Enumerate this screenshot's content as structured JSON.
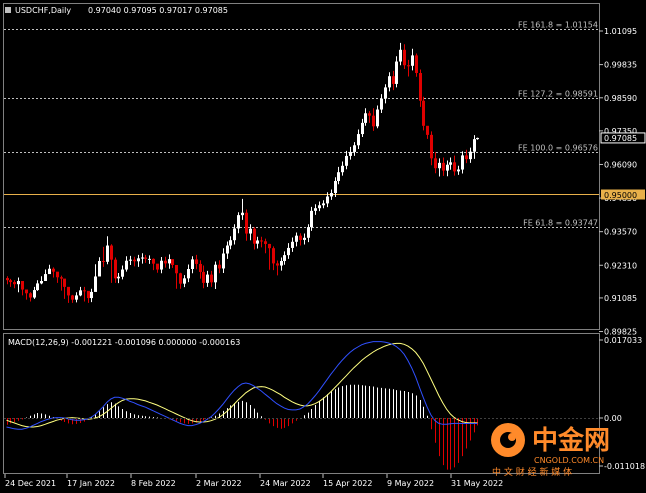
{
  "header": {
    "symbol": "USDCHF,Daily",
    "ohlc": "0.97040 0.97095 0.97017 0.97085"
  },
  "price_scale": {
    "labels": [
      "1.01095",
      "0.99835",
      "0.98590",
      "0.97350",
      "0.96090",
      "0.94830",
      "0.93570",
      "0.92310",
      "0.91085",
      "0.89825"
    ],
    "values": [
      1.01095,
      0.99835,
      0.9859,
      0.9735,
      0.9609,
      0.9483,
      0.9357,
      0.9231,
      0.91085,
      0.89825
    ],
    "current_price_label": "0.97085",
    "current_price": 0.97085,
    "level_label": "0.95000",
    "level": 0.95
  },
  "fib_levels": [
    {
      "label": "FE 161.8 = 1.01154",
      "value": 1.01154
    },
    {
      "label": "FE 127.2 = 0.98591",
      "value": 0.98591
    },
    {
      "label": "FE 100.0 = 0.96576",
      "value": 0.96576
    },
    {
      "label": "FE 61.8 = 0.93747",
      "value": 0.93747
    }
  ],
  "macd": {
    "header": "MACD(12,26,9) -0.001221 -0.001096 0.000000 -0.000163",
    "scale_labels": [
      "0.017033",
      "0.00",
      "-0.011018"
    ]
  },
  "time_axis": [
    "24 Dec 2021",
    "17 Jan 2022",
    "8 Feb 2022",
    "2 Mar 2022",
    "24 Mar 2022",
    "15 Apr 2022",
    "9 May 2022",
    "31 May 2022"
  ],
  "watermark": {
    "brand": "中金网",
    "sub": "中 文 财 经 新 媒 体",
    "url": "CNGOLD.COM.CN"
  },
  "colors": {
    "background": "#000000",
    "bull": "#ffffff",
    "bear": "#e00000",
    "grid": "#c0c0c0",
    "level_line": "#e8b04a",
    "macd_signal": "#ffff80",
    "macd_main": "#3050ff",
    "hist_pos": "#ffffff",
    "hist_neg": "#e00000",
    "watermark": "#ff8a2a"
  },
  "chart_data": {
    "type": "candlestick",
    "closes": [
      0.9175,
      0.9168,
      0.916,
      0.9172,
      0.914,
      0.9126,
      0.911,
      0.9138,
      0.9163,
      0.9172,
      0.9198,
      0.9218,
      0.9207,
      0.9186,
      0.9181,
      0.915,
      0.9118,
      0.9102,
      0.9118,
      0.9137,
      0.9135,
      0.9108,
      0.9131,
      0.9189,
      0.9247,
      0.9244,
      0.9305,
      0.9252,
      0.9182,
      0.9188,
      0.9215,
      0.9248,
      0.9252,
      0.9246,
      0.9257,
      0.926,
      0.9255,
      0.9255,
      0.9237,
      0.9215,
      0.9248,
      0.9238,
      0.9254,
      0.9232,
      0.9201,
      0.9162,
      0.9182,
      0.9217,
      0.9253,
      0.9236,
      0.9206,
      0.9165,
      0.9196,
      0.9167,
      0.9233,
      0.9219,
      0.9275,
      0.9305,
      0.9325,
      0.9369,
      0.9419,
      0.9428,
      0.935,
      0.9368,
      0.9312,
      0.9324,
      0.9321,
      0.9311,
      0.9295,
      0.9238,
      0.923,
      0.9247,
      0.9269,
      0.9296,
      0.9319,
      0.9342,
      0.9326,
      0.9334,
      0.9374,
      0.9435,
      0.9445,
      0.9456,
      0.9463,
      0.9489,
      0.9502,
      0.9547,
      0.958,
      0.9604,
      0.9641,
      0.9656,
      0.9681,
      0.9723,
      0.9765,
      0.9801,
      0.9792,
      0.9752,
      0.9815,
      0.9856,
      0.9898,
      0.994,
      0.9911,
      0.9995,
      1.0039,
      0.9981,
      0.9979,
      1.0018,
      0.9952,
      0.9848,
      0.9754,
      0.972,
      0.9632,
      0.9595,
      0.9615,
      0.9586,
      0.9608,
      0.9617,
      0.9583,
      0.959,
      0.9643,
      0.9629,
      0.9657,
      0.9704,
      0.97085
    ],
    "highs": [
      0.919,
      0.918,
      0.9175,
      0.9185,
      0.916,
      0.914,
      0.913,
      0.915,
      0.9175,
      0.919,
      0.9215,
      0.9233,
      0.9223,
      0.9203,
      0.9192,
      0.917,
      0.914,
      0.912,
      0.913,
      0.915,
      0.915,
      0.9125,
      0.9143,
      0.9235,
      0.9261,
      0.93,
      0.934,
      0.931,
      0.926,
      0.9202,
      0.923,
      0.9265,
      0.9266,
      0.9263,
      0.927,
      0.9276,
      0.927,
      0.9268,
      0.9257,
      0.9235,
      0.9262,
      0.9263,
      0.9272,
      0.9252,
      0.9232,
      0.9203,
      0.9194,
      0.9234,
      0.9265,
      0.927,
      0.925,
      0.923,
      0.921,
      0.921,
      0.9245,
      0.925,
      0.9295,
      0.932,
      0.934,
      0.9385,
      0.943,
      0.948,
      0.944,
      0.9385,
      0.9374,
      0.9338,
      0.9338,
      0.9331,
      0.9311,
      0.9302,
      0.9249,
      0.926,
      0.9283,
      0.9314,
      0.9335,
      0.9354,
      0.9351,
      0.935,
      0.9385,
      0.945,
      0.946,
      0.947,
      0.9475,
      0.9505,
      0.9515,
      0.9561,
      0.96,
      0.962,
      0.966,
      0.9675,
      0.9693,
      0.974,
      0.978,
      0.982,
      0.9809,
      0.982,
      0.983,
      0.9873,
      0.991,
      0.9955,
      0.996,
      1.0015,
      1.0065,
      1.006,
      1.0001,
      1.0043,
      1.0025,
      0.9965,
      0.9863,
      0.9736,
      0.9733,
      0.9655,
      0.9632,
      0.9635,
      0.9624,
      0.9635,
      0.9642,
      0.9604,
      0.9658,
      0.9664,
      0.9672,
      0.9719,
      0.97095
    ],
    "lows": [
      0.916,
      0.915,
      0.9145,
      0.913,
      0.9118,
      0.9102,
      0.9095,
      0.9105,
      0.9135,
      0.916,
      0.918,
      0.92,
      0.9185,
      0.9165,
      0.9136,
      0.9105,
      0.909,
      0.909,
      0.9092,
      0.9115,
      0.9095,
      0.909,
      0.9093,
      0.917,
      0.922,
      0.9225,
      0.9235,
      0.9165,
      0.9165,
      0.9164,
      0.9178,
      0.9207,
      0.9232,
      0.9227,
      0.9225,
      0.9237,
      0.924,
      0.9236,
      0.9213,
      0.9203,
      0.9201,
      0.9222,
      0.9218,
      0.9221,
      0.9143,
      0.9143,
      0.9149,
      0.9168,
      0.9201,
      0.9216,
      0.9181,
      0.9145,
      0.915,
      0.915,
      0.9142,
      0.9201,
      0.9202,
      0.9255,
      0.9291,
      0.9309,
      0.9351,
      0.9401,
      0.9323,
      0.9325,
      0.929,
      0.9294,
      0.9298,
      0.9276,
      0.9214,
      0.9213,
      0.9193,
      0.9211,
      0.9233,
      0.9255,
      0.9281,
      0.9302,
      0.9305,
      0.9309,
      0.9318,
      0.936,
      0.942,
      0.9434,
      0.9445,
      0.9449,
      0.9476,
      0.9487,
      0.9535,
      0.9567,
      0.9591,
      0.9627,
      0.9641,
      0.9667,
      0.9712,
      0.9754,
      0.9765,
      0.9735,
      0.9745,
      0.9802,
      0.9838,
      0.9883,
      0.9888,
      0.9898,
      0.9981,
      0.9967,
      0.9939,
      0.9962,
      0.9938,
      0.9825,
      0.9737,
      0.9705,
      0.9606,
      0.9576,
      0.9564,
      0.9566,
      0.9565,
      0.9589,
      0.9567,
      0.957,
      0.9575,
      0.9614,
      0.9615,
      0.963,
      0.97017
    ],
    "macd_histogram": [
      -0.0015,
      -0.0012,
      -0.0009,
      -0.0006,
      -0.0003,
      0.0001,
      0.0005,
      0.0008,
      0.0011,
      0.001,
      0.0008,
      0.0005,
      0.0002,
      -0.0002,
      -0.0006,
      -0.0009,
      -0.0012,
      -0.0014,
      -0.0013,
      -0.0011,
      -0.0008,
      -0.0004,
      0.0001,
      0.0008,
      0.0015,
      0.0024,
      0.0031,
      0.0035,
      0.0032,
      0.0026,
      0.002,
      0.0015,
      0.0011,
      0.0008,
      0.0006,
      0.0005,
      0.0004,
      0.0003,
      0.0002,
      0.0001,
      0.0,
      -0.0002,
      -0.0003,
      -0.0005,
      -0.0007,
      -0.001,
      -0.0012,
      -0.0013,
      -0.0012,
      -0.001,
      -0.0008,
      -0.0005,
      -0.0002,
      0.0001,
      0.0005,
      0.001,
      0.0016,
      0.0022,
      0.0028,
      0.0033,
      0.0036,
      0.0038,
      0.0035,
      0.0029,
      0.0021,
      0.0012,
      0.0004,
      -0.0004,
      -0.0012,
      -0.0018,
      -0.0022,
      -0.0024,
      -0.0022,
      -0.0018,
      -0.0012,
      -0.0006,
      0.0,
      0.0006,
      0.0012,
      0.002,
      0.0029,
      0.0038,
      0.0046,
      0.0053,
      0.0059,
      0.0064,
      0.0068,
      0.0071,
      0.0073,
      0.0074,
      0.0074,
      0.0074,
      0.0073,
      0.0072,
      0.0071,
      0.007,
      0.0068,
      0.0067,
      0.0066,
      0.0065,
      0.0064,
      0.0062,
      0.0061,
      0.006,
      0.0058,
      0.0055,
      0.005,
      0.004,
      0.0025,
      0.0005,
      -0.0025,
      -0.0055,
      -0.0085,
      -0.0105,
      -0.0115,
      -0.0115,
      -0.011,
      -0.01,
      -0.0085,
      -0.0068,
      -0.005,
      -0.0032,
      -0.00163
    ],
    "macd_main": [
      -0.002,
      -0.0022,
      -0.0024,
      -0.0025,
      -0.0025,
      -0.0023,
      -0.002,
      -0.0016,
      -0.0012,
      -0.0008,
      -0.0005,
      -0.0002,
      0.0,
      0.0001,
      0.0001,
      0.0,
      -0.0002,
      -0.0004,
      -0.0005,
      -0.0005,
      -0.0004,
      -0.0002,
      0.0002,
      0.0008,
      0.0016,
      0.0025,
      0.0035,
      0.0042,
      0.0046,
      0.0046,
      0.0044,
      0.0041,
      0.0037,
      0.0034,
      0.003,
      0.0027,
      0.0024,
      0.002,
      0.0016,
      0.0012,
      0.0008,
      0.0004,
      0.0,
      -0.0004,
      -0.0008,
      -0.0012,
      -0.0015,
      -0.0017,
      -0.0017,
      -0.0015,
      -0.0012,
      -0.0008,
      -0.0003,
      0.0003,
      0.0011,
      0.002,
      0.003,
      0.0041,
      0.0052,
      0.0062,
      0.007,
      0.0076,
      0.0078,
      0.0076,
      0.0072,
      0.0066,
      0.006,
      0.0053,
      0.0046,
      0.0039,
      0.0032,
      0.0027,
      0.0022,
      0.0019,
      0.0018,
      0.0018,
      0.002,
      0.0025,
      0.0031,
      0.004,
      0.005,
      0.0061,
      0.0073,
      0.0085,
      0.0097,
      0.0108,
      0.0119,
      0.0129,
      0.0138,
      0.0146,
      0.0153,
      0.0158,
      0.0163,
      0.0166,
      0.0168,
      0.017,
      0.017,
      0.017,
      0.0169,
      0.0167,
      0.0164,
      0.0159,
      0.0152,
      0.0142,
      0.0128,
      0.0111,
      0.0091,
      0.0068,
      0.0045,
      0.0024,
      0.0006,
      -0.0006,
      -0.0012,
      -0.0014,
      -0.0014,
      -0.0013,
      -0.0012,
      -0.0012,
      -0.00122,
      -0.00122,
      -0.00122,
      -0.00122,
      -0.001221
    ],
    "macd_signal": [
      -0.0005,
      -0.0008,
      -0.0011,
      -0.0014,
      -0.0017,
      -0.0019,
      -0.002,
      -0.002,
      -0.0019,
      -0.0017,
      -0.0014,
      -0.0011,
      -0.0008,
      -0.0005,
      -0.0003,
      -0.0001,
      0.0,
      0.0001,
      0.0,
      -0.0001,
      -0.0002,
      -0.0003,
      -0.0002,
      0.0,
      0.0003,
      0.0008,
      0.0014,
      0.0021,
      0.0028,
      0.0034,
      0.0039,
      0.0042,
      0.0043,
      0.0043,
      0.0042,
      0.004,
      0.0038,
      0.0035,
      0.0032,
      0.0029,
      0.0025,
      0.0021,
      0.0017,
      0.0013,
      0.0009,
      0.0005,
      0.0001,
      -0.0003,
      -0.0006,
      -0.0008,
      -0.0009,
      -0.0009,
      -0.0008,
      -0.0006,
      -0.0003,
      0.0001,
      0.0007,
      0.0014,
      0.0022,
      0.0031,
      0.004,
      0.0048,
      0.0056,
      0.0062,
      0.0067,
      0.0069,
      0.007,
      0.0069,
      0.0066,
      0.0062,
      0.0057,
      0.0052,
      0.0046,
      0.0041,
      0.0036,
      0.0032,
      0.0029,
      0.0027,
      0.0027,
      0.0029,
      0.0032,
      0.0037,
      0.0043,
      0.005,
      0.0058,
      0.0067,
      0.0076,
      0.0085,
      0.0094,
      0.0103,
      0.0112,
      0.012,
      0.0128,
      0.0135,
      0.0141,
      0.0147,
      0.0152,
      0.0156,
      0.016,
      0.0163,
      0.0165,
      0.0166,
      0.0166,
      0.0164,
      0.016,
      0.0154,
      0.0146,
      0.0135,
      0.0121,
      0.0104,
      0.0086,
      0.0068,
      0.005,
      0.0034,
      0.002,
      0.0009,
      0.0001,
      -0.0004,
      -0.0008,
      -0.001,
      -0.00108,
      -0.0011,
      -0.001096
    ]
  }
}
